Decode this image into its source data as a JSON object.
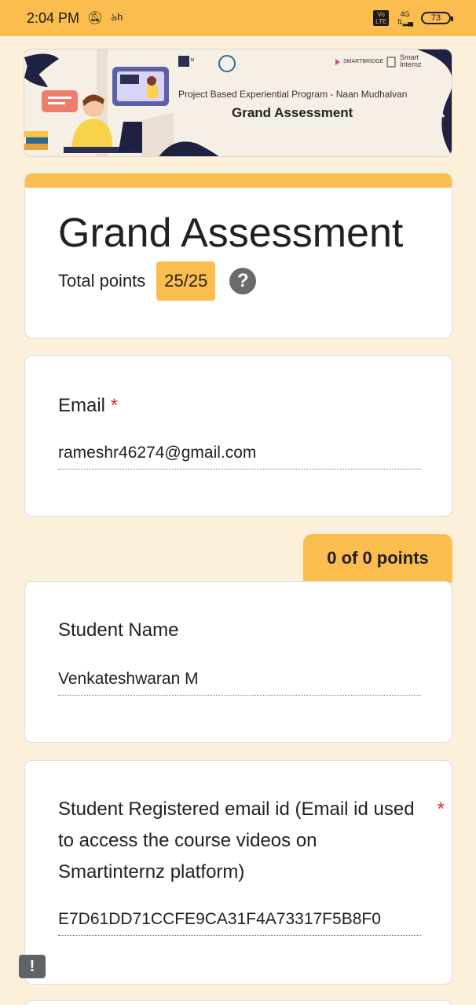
{
  "status_bar": {
    "time": "2:04 PM",
    "volte_label": "Vo LTE",
    "network": "4G",
    "battery": "73"
  },
  "banner": {
    "subtitle": "Project Based Experiential Program - Naan Mudhalvan",
    "title": "Grand Assessment",
    "logo_smartbridge": "SMARTBRIDGE",
    "logo_smartinternz": "Smart Internz"
  },
  "form": {
    "title": "Grand Assessment",
    "total_points_label": "Total points",
    "total_points_value": "25/25",
    "help_icon": "?"
  },
  "questions": [
    {
      "label": "Email",
      "required": true,
      "answer": "rameshr46274@gmail.com"
    },
    {
      "points": "0 of 0 points",
      "label": "Student Name",
      "required": false,
      "answer": "Venkateshwaran M"
    },
    {
      "label": "Student Registered email id (Email id used to access the course videos on Smartinternz platform)",
      "required": true,
      "answer": "E7D61DD71CCFE9CA31F4A73317F5B8F0"
    }
  ],
  "required_marker": "*",
  "feedback_icon": "!",
  "colors": {
    "accent": "#fbbd4d",
    "background": "#fdf0da",
    "required": "#d93025"
  }
}
